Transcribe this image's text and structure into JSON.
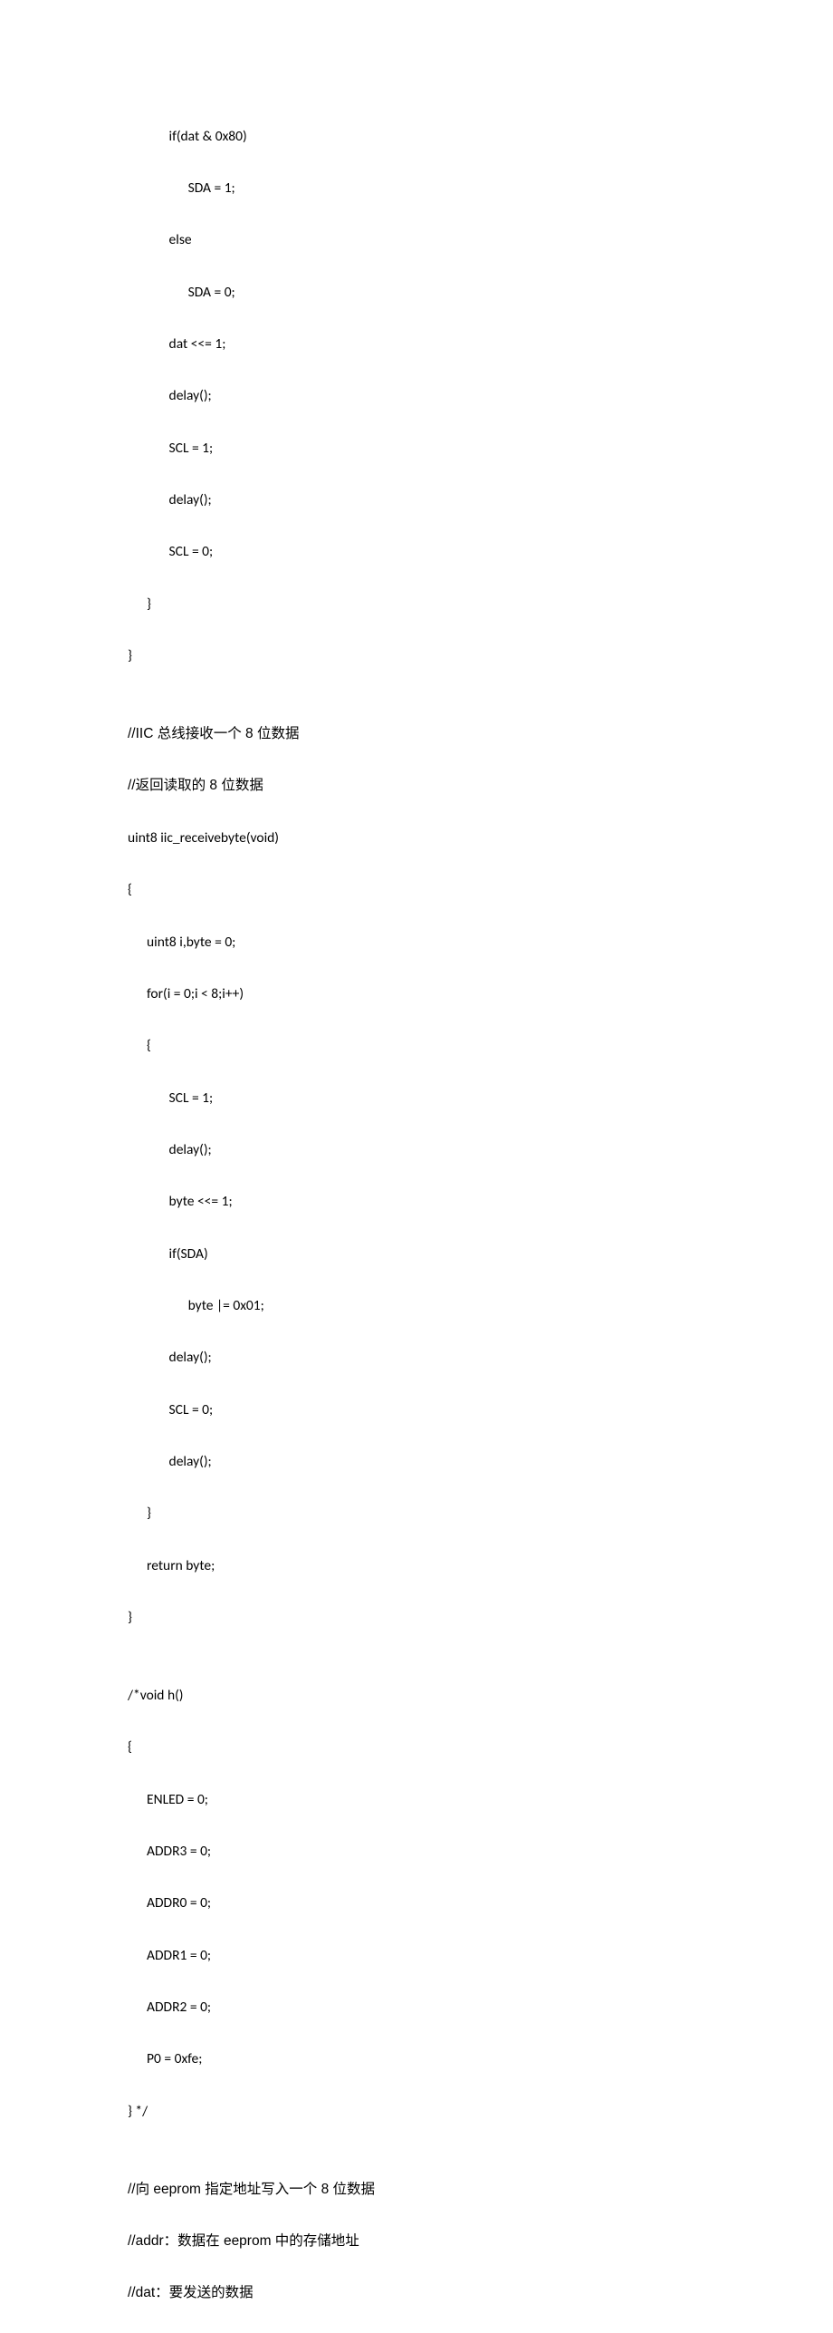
{
  "document": {
    "type": "code",
    "lines": [
      "             if(dat & 0x80)",
      "                   SDA = 1;",
      "             else",
      "                   SDA = 0;",
      "             dat <<= 1;",
      "             delay();",
      "             SCL = 1;",
      "             delay();",
      "             SCL = 0;",
      "      }",
      "}",
      "",
      "//IIC 总线接收一个 8 位数据",
      "//返回读取的 8 位数据",
      "uint8 iic_receivebyte(void)",
      "{",
      "      uint8 i,byte = 0;",
      "      for(i = 0;i < 8;i++)",
      "      {",
      "             SCL = 1;",
      "             delay();",
      "             byte <<= 1;",
      "             if(SDA)",
      "                   byte |= 0x01;",
      "             delay();",
      "             SCL = 0;",
      "             delay();",
      "      }",
      "      return byte;",
      "}",
      "",
      "/*void h()",
      "{",
      "      ENLED = 0;",
      "      ADDR3 = 0;",
      "      ADDR0 = 0;",
      "      ADDR1 = 0;",
      "      ADDR2 = 0;",
      "      P0 = 0xfe;",
      "} */",
      "",
      "//向 eeprom 指定地址写入一个 8 位数据",
      "//addr：数据在 eeprom 中的存储地址",
      "//dat：要发送的数据"
    ]
  }
}
